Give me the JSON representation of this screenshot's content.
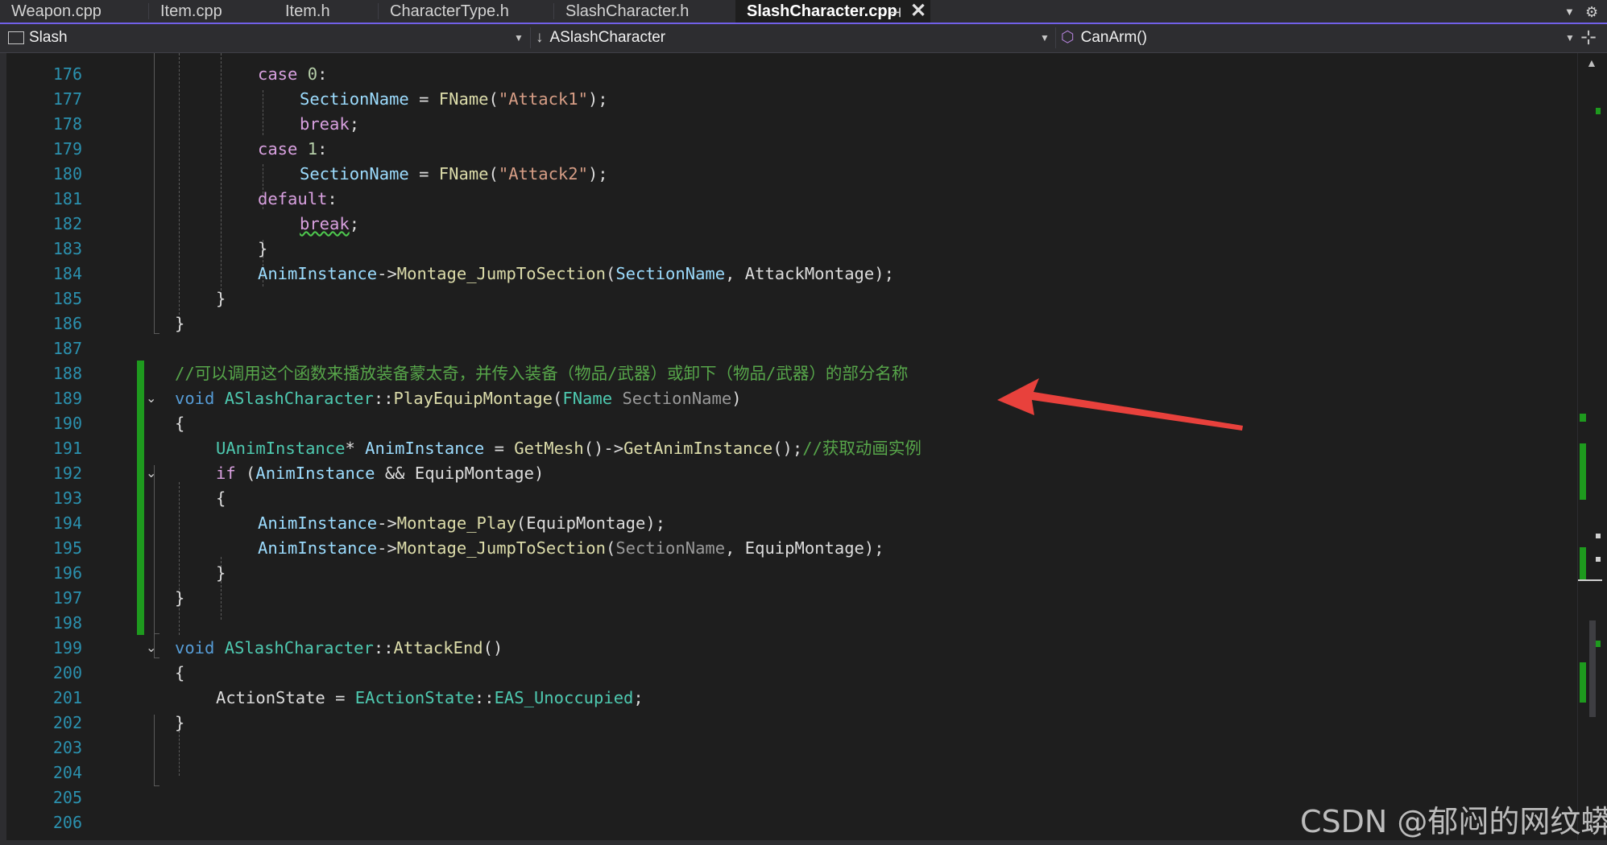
{
  "tabs": [
    {
      "label": "Weapon.cpp",
      "active": false
    },
    {
      "label": "Item.cpp",
      "active": false
    },
    {
      "label": "Item.h",
      "active": false
    },
    {
      "label": "CharacterType.h",
      "active": false
    },
    {
      "label": "SlashCharacter.h",
      "active": false
    },
    {
      "label": "SlashCharacter.cpp",
      "active": true
    }
  ],
  "tab_icons": {
    "pin": "pin-icon",
    "close": "close-icon",
    "overflow": "chevron-down-icon",
    "settings": "gear-icon"
  },
  "navbar": {
    "project": "Slash",
    "scope": "ASlashCharacter",
    "member": "CanArm()"
  },
  "code_lines": [
    {
      "n": "176"
    },
    {
      "n": "177"
    },
    {
      "n": "178"
    },
    {
      "n": "179"
    },
    {
      "n": "180"
    },
    {
      "n": "181"
    },
    {
      "n": "182"
    },
    {
      "n": "183"
    },
    {
      "n": "184"
    },
    {
      "n": "185"
    },
    {
      "n": "186"
    },
    {
      "n": "187"
    },
    {
      "n": "188"
    },
    {
      "n": "189"
    },
    {
      "n": "190"
    },
    {
      "n": "191"
    },
    {
      "n": "192"
    },
    {
      "n": "193"
    },
    {
      "n": "194"
    },
    {
      "n": "195"
    },
    {
      "n": "196"
    },
    {
      "n": "197"
    },
    {
      "n": "198"
    },
    {
      "n": "199"
    },
    {
      "n": "200"
    },
    {
      "n": "201"
    },
    {
      "n": "202"
    },
    {
      "n": "203"
    },
    {
      "n": "204"
    },
    {
      "n": "205"
    },
    {
      "n": "206"
    }
  ],
  "code": {
    "l176": [
      "case",
      "0",
      ":"
    ],
    "l177": [
      "SectionName",
      " = ",
      "FName",
      "(",
      "\"Attack1\"",
      ");"
    ],
    "l178": [
      "break",
      ";"
    ],
    "l179": [
      "case",
      "1",
      ":"
    ],
    "l180": [
      "SectionName",
      " = ",
      "FName",
      "(",
      "\"Attack2\"",
      ");"
    ],
    "l181": [
      "default",
      ":"
    ],
    "l182": [
      "break",
      ";"
    ],
    "l183": [
      "}"
    ],
    "l184": [
      "AnimInstance",
      "->",
      "Montage_JumpToSection",
      "(",
      "SectionName",
      ", ",
      "AttackMontage",
      ");"
    ],
    "l185": [
      "}"
    ],
    "l186": [
      "}"
    ],
    "l188": [
      "//可以调用这个函数来播放装备蒙太奇，并传入装备（物品/武器）或卸下（物品/武器）的部分名称"
    ],
    "l189": [
      "void",
      " ",
      "ASlashCharacter",
      "::",
      "PlayEquipMontage",
      "(",
      "FName",
      " ",
      "SectionName",
      ")"
    ],
    "l190": [
      "{"
    ],
    "l191": [
      "UAnimInstance",
      "* ",
      "AnimInstance",
      " = ",
      "GetMesh",
      "()->",
      "GetAnimInstance",
      "();",
      "//获取动画实例"
    ],
    "l192": [
      "if",
      " (",
      "AnimInstance",
      " && ",
      "EquipMontage",
      ")"
    ],
    "l193": [
      "{"
    ],
    "l194": [
      "AnimInstance",
      "->",
      "Montage_Play",
      "(",
      "EquipMontage",
      ");"
    ],
    "l195": [
      "AnimInstance",
      "->",
      "Montage_JumpToSection",
      "(",
      "SectionName",
      ", ",
      "EquipMontage",
      ");"
    ],
    "l196": [
      "}"
    ],
    "l197": [
      "}"
    ],
    "l199": [
      "void",
      " ",
      "ASlashCharacter",
      "::",
      "AttackEnd",
      "()"
    ],
    "l200": [
      "{"
    ],
    "l201": [
      "ActionState",
      " = ",
      "EActionState",
      "::",
      "EAS_Unoccupied",
      ";"
    ],
    "l202": [
      "}"
    ]
  },
  "watermark": "CSDN @郁闷的网纹蟒",
  "colors": {
    "background": "#1e1e1e",
    "keyword": "#569cd6",
    "control": "#d8a0df",
    "string": "#d69d85",
    "function": "#dcdcaa",
    "type": "#4ec9b0",
    "variable": "#9cdcfe",
    "comment": "#57a64a",
    "line_number": "#2b91af",
    "change_bar": "#1e9a1e",
    "arrow": "#e8413c",
    "accent": "#7160e8"
  }
}
